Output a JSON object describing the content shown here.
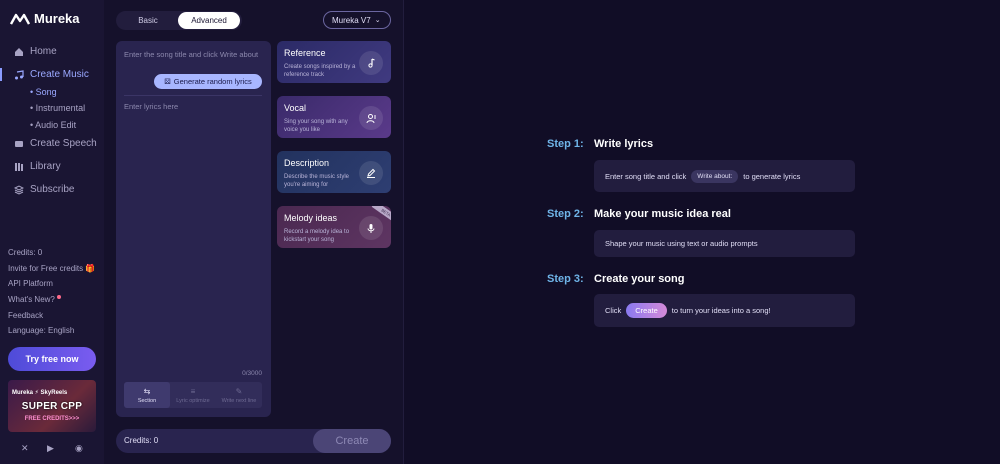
{
  "brand": {
    "name": "Mureka"
  },
  "sidebar": {
    "nav": [
      {
        "label": "Home",
        "icon": "home-icon"
      },
      {
        "label": "Create Music",
        "icon": "music-icon"
      },
      {
        "label": "Create Speech",
        "icon": "speech-icon"
      },
      {
        "label": "Library",
        "icon": "library-icon"
      },
      {
        "label": "Subscribe",
        "icon": "subscribe-icon"
      }
    ],
    "sub": [
      "Song",
      "Instrumental",
      "Audio Edit"
    ],
    "links": {
      "credits": "Credits: 0",
      "invite": "Invite for Free credits",
      "api": "API Platform",
      "whats_new": "What's New?",
      "feedback": "Feedback",
      "language": "Language: English"
    },
    "try_button": "Try free now",
    "promo": {
      "top": "Mureka ⚡ SkyReels",
      "main": "SUPER CPP",
      "sub": "FREE CREDITS>>>"
    }
  },
  "editor": {
    "modes": [
      "Basic",
      "Advanced"
    ],
    "active_mode": "Advanced",
    "model": "Mureka V7",
    "title_placeholder": "Enter the song title and click Write about",
    "generate_button": "Generate random lyrics",
    "lyrics_placeholder": "Enter lyrics here",
    "counter": "0/3000",
    "tools": [
      "Section",
      "Lyric optimize",
      "Write next line"
    ],
    "credits": "Credits: 0",
    "create_button": "Create"
  },
  "cards": [
    {
      "title": "Reference",
      "desc": "Create songs inspired by a reference track"
    },
    {
      "title": "Vocal",
      "desc": "Sing your song with any voice you like"
    },
    {
      "title": "Description",
      "desc": "Describe the music style you're aiming for"
    },
    {
      "title": "Melody ideas",
      "desc": "Record a melody idea to kickstart your song",
      "badge": "BETA"
    }
  ],
  "steps": [
    {
      "label": "Step 1:",
      "title": "Write lyrics",
      "pre": "Enter song title and click",
      "chip": "Write about:",
      "post": "to generate lyrics"
    },
    {
      "label": "Step 2:",
      "title": "Make your music idea real",
      "text": "Shape your music using text or audio prompts"
    },
    {
      "label": "Step 3:",
      "title": "Create your song",
      "pre": "Click",
      "chip": "Create",
      "post": "to turn your ideas into a song!"
    }
  ]
}
